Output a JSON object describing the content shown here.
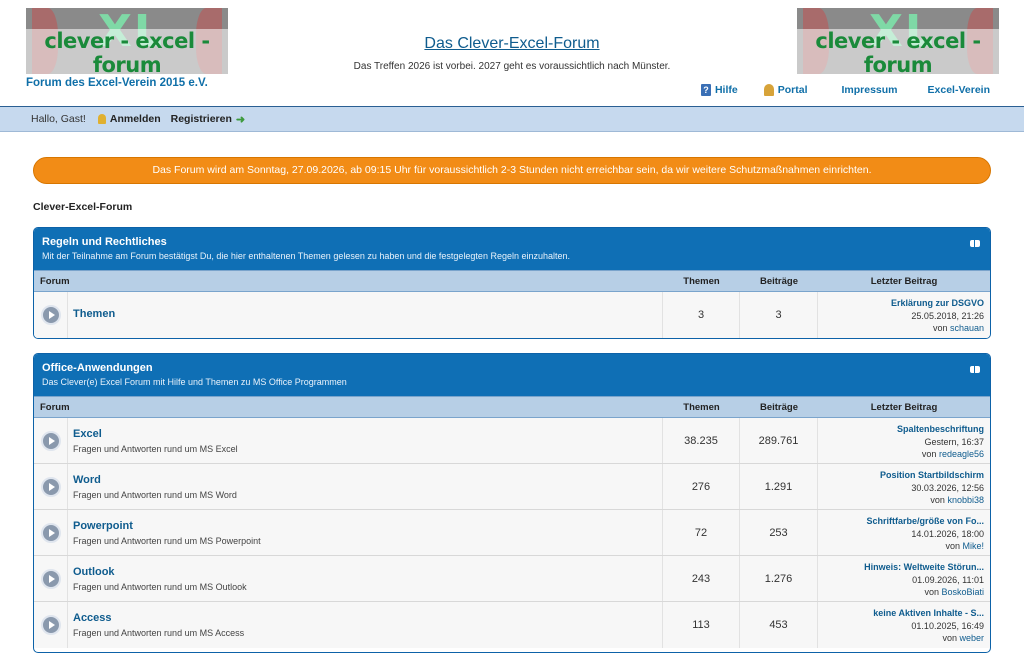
{
  "header": {
    "logo_big": "XL",
    "logo_tag": "clever - excel - forum",
    "subtitle": "Forum des Excel-Verein 2015 e.V.",
    "site_title": "Das Clever-Excel-Forum",
    "site_desc": "Das Treffen 2026 ist vorbei. 2027 geht es voraussichtlich nach Münster.",
    "links": [
      {
        "label": "Hilfe",
        "icon": "help-icon"
      },
      {
        "label": "Portal",
        "icon": "portal-icon"
      },
      {
        "label": "Impressum"
      },
      {
        "label": "Excel-Verein"
      }
    ]
  },
  "userbar": {
    "greeting": "Hallo, Gast!",
    "login": "Anmelden",
    "register": "Registrieren"
  },
  "notice": "Das Forum wird am Sonntag, 27.09.2026, ab 09:15 Uhr für voraussichtlich 2-3 Stunden nicht erreichbar sein, da wir weitere Schutzmaßnahmen einrichten.",
  "breadcrumb": "Clever-Excel-Forum",
  "columns": {
    "forum": "Forum",
    "themen": "Themen",
    "beitraege": "Beiträge",
    "last": "Letzter Beitrag"
  },
  "categories": [
    {
      "title": "Regeln und Rechtliches",
      "desc": "Mit der Teilnahme am Forum bestätigst Du, die hier enthaltenen Themen gelesen zu haben und die festgelegten Regeln einzuhalten.",
      "forums": [
        {
          "name": "Themen",
          "desc": "",
          "themen": "3",
          "beitraege": "3",
          "last_title": "Erklärung zur DSGVO",
          "last_date": "25.05.2018, 21:26",
          "last_by": "von",
          "last_user": "schauan"
        }
      ]
    },
    {
      "title": "Office-Anwendungen",
      "desc": "Das Clever(e) Excel Forum mit Hilfe und Themen zu MS Office Programmen",
      "forums": [
        {
          "name": "Excel",
          "desc": "Fragen und Antworten rund um MS Excel",
          "themen": "38.235",
          "beitraege": "289.761",
          "last_title": "Spaltenbeschriftung",
          "last_date": "Gestern, 16:37",
          "last_by": "von",
          "last_user": "redeagle56"
        },
        {
          "name": "Word",
          "desc": "Fragen und Antworten rund um MS Word",
          "themen": "276",
          "beitraege": "1.291",
          "last_title": "Position Startbildschirm",
          "last_date": "30.03.2026, 12:56",
          "last_by": "von",
          "last_user": "knobbi38"
        },
        {
          "name": "Powerpoint",
          "desc": "Fragen und Antworten rund um MS Powerpoint",
          "themen": "72",
          "beitraege": "253",
          "last_title": "Schriftfarbe/größe von Fo...",
          "last_date": "14.01.2026, 18:00",
          "last_by": "von",
          "last_user": "Mike!"
        },
        {
          "name": "Outlook",
          "desc": "Fragen und Antworten rund um MS Outlook",
          "themen": "243",
          "beitraege": "1.276",
          "last_title": "Hinweis: Weltweite Störun...",
          "last_date": "01.09.2026, 11:01",
          "last_by": "von",
          "last_user": "BoskoBiati"
        },
        {
          "name": "Access",
          "desc": "Fragen und Antworten rund um MS Access",
          "themen": "113",
          "beitraege": "453",
          "last_title": "keine Aktiven Inhalte - S...",
          "last_date": "01.10.2025, 16:49",
          "last_by": "von",
          "last_user": "weber"
        }
      ]
    }
  ]
}
